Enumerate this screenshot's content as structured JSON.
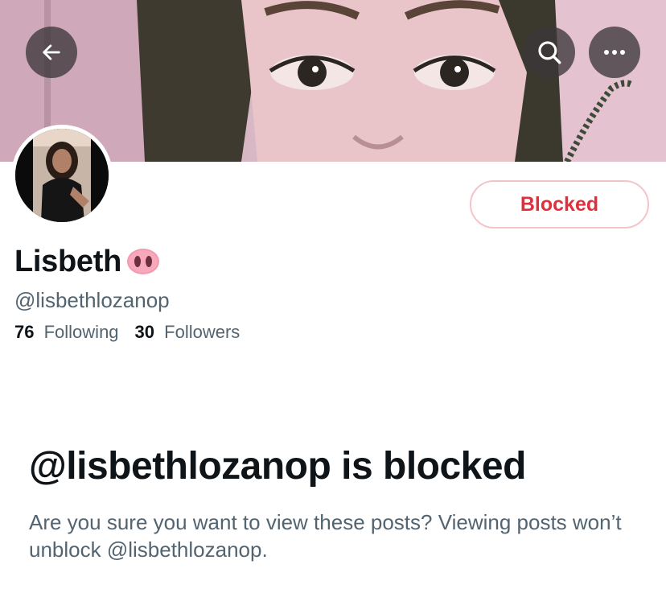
{
  "profile": {
    "display_name": "Lisbeth",
    "name_emoji": "pig-nose",
    "handle": "@lisbethlozanop",
    "following_count": "76",
    "following_label": "Following",
    "followers_count": "30",
    "followers_label": "Followers"
  },
  "header": {
    "back_icon": "arrow-left-icon",
    "search_icon": "search-icon",
    "more_icon": "more-horizontal-icon"
  },
  "action_button": {
    "label": "Blocked",
    "color": "#e0303b"
  },
  "blocked_notice": {
    "title": "@lisbethlozanop is blocked",
    "description": "Are you sure you want to view these posts? Viewing posts won’t unblock @lisbethlozanop."
  },
  "colors": {
    "text_primary": "#0f1419",
    "text_secondary": "#536471",
    "blocked_border": "#f4c4c9"
  }
}
